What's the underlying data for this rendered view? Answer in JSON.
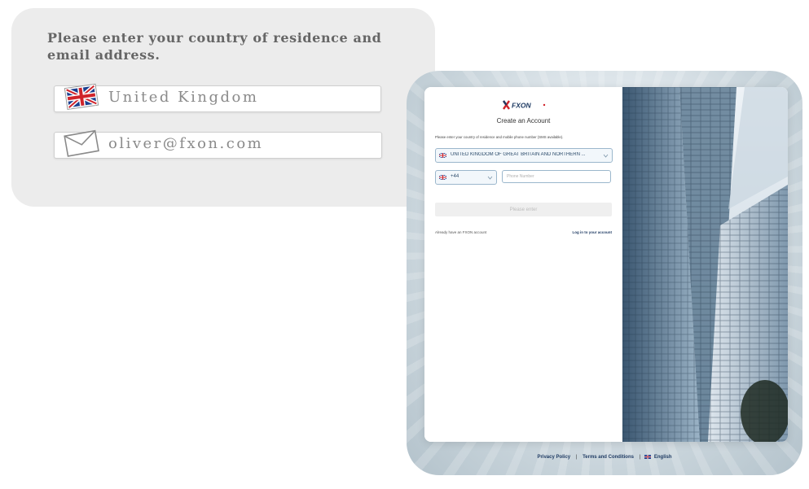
{
  "callout": {
    "instruction": "Please enter your country of residence and email address.",
    "country_value": "United Kingdom",
    "email_value": "oliver@fxon.com"
  },
  "modal": {
    "logo_text": "FXON",
    "title": "Create an Account",
    "note": "Please enter your country of residence and mobile phone number (SMS available).",
    "country_select": "UNITED KINGDOM OF GREAT BRITAIN AND NORTHERN ...",
    "dial_code": "+44",
    "phone_placeholder": "Phone Number",
    "submit_label": "Please enter",
    "have_account": "Already have an FXON account",
    "login_link": "Log in to your account"
  },
  "footer": {
    "privacy": "Privacy Policy",
    "terms": "Terms and Conditions",
    "language": "English"
  },
  "colors": {
    "accent_navy": "#1f3b63",
    "logo_red": "#d0232a",
    "select_border": "#9bb7cc"
  },
  "icons": [
    "uk-flag-icon",
    "envelope-icon",
    "chevron-down-icon",
    "fxon-logo"
  ]
}
